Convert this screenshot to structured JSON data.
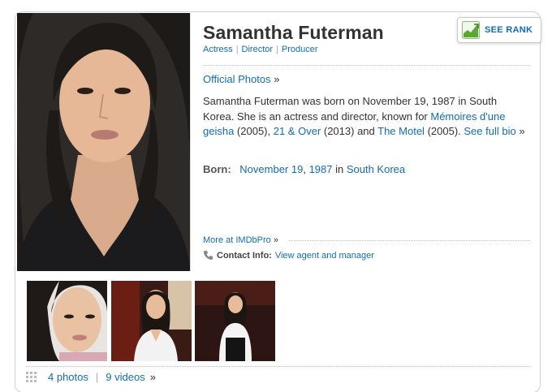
{
  "person": {
    "name": "Samantha Futerman",
    "jobs": [
      "Actress",
      "Director",
      "Producer"
    ]
  },
  "rank_button": {
    "label": "SEE RANK"
  },
  "official_photos": {
    "label": "Official Photos",
    "arrow": "»"
  },
  "bio": {
    "text_1": "Samantha Futerman was born on November 19, 1987 in South Korea. She is an actress and director, known for ",
    "film_1": "Mémoires d'une geisha",
    "year_1": " (2005), ",
    "film_2": "21 & Over",
    "year_2": " (2013) and ",
    "film_3": "The Motel",
    "year_3": " (2005). ",
    "full_bio": "See full bio",
    "arrow": "»"
  },
  "born": {
    "label": "Born:",
    "date_md": "November 19",
    "comma": ", ",
    "year": "1987",
    "in_text": " in ",
    "place": "South Korea"
  },
  "pro": {
    "label": "More at IMDbPro",
    "arrow": "»"
  },
  "contact": {
    "label": "Contact Info:",
    "link": "View agent and manager"
  },
  "media": {
    "photos": "4 photos",
    "separator": "|",
    "videos": "9 videos",
    "arrow": "»"
  },
  "colors": {
    "link": "#136cb2",
    "text": "#333333",
    "rank_green": "#5aa732"
  }
}
